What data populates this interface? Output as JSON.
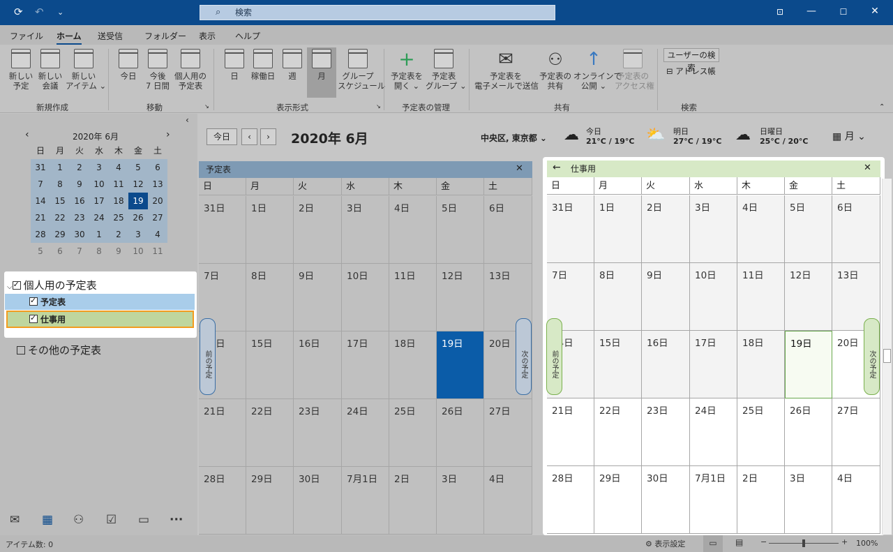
{
  "titlebar": {
    "search_placeholder": "検索",
    "undo": "↶",
    "redo": "↷",
    "more": "⌄"
  },
  "menu": [
    "ファイル",
    "ホーム",
    "送受信",
    "フォルダー",
    "表示",
    "ヘルプ"
  ],
  "ribbon": {
    "groups": [
      "新規作成",
      "移動",
      "表示形式",
      "予定表の管理",
      "共有",
      "検索"
    ],
    "new_appt": "新しい\n予定",
    "new_meeting": "新しい\n会議",
    "new_item": "新しい\nアイテム ⌄",
    "today": "今日",
    "next7": "今後\n7 日間",
    "personal": "個人用の\n予定表",
    "day": "日",
    "workweek": "稼働日",
    "week": "週",
    "month": "月",
    "schedule": "グループ\nスケジュール",
    "open_cal": "予定表を\n開く ⌄",
    "cal_groups": "予定表\nグループ ⌄",
    "email_cal": "予定表を\n電子メールで送信",
    "share_cal": "予定表の\n共有",
    "publish": "オンラインで\n公開 ⌄",
    "perm": "予定表の\nアクセス権",
    "search_people": "ユーザーの検索",
    "address_book": "アドレス帳"
  },
  "minical": {
    "title": "2020年 6月",
    "days": [
      "日",
      "月",
      "火",
      "水",
      "木",
      "金",
      "土"
    ],
    "weeks": [
      [
        "31",
        "1",
        "2",
        "3",
        "4",
        "5",
        "6"
      ],
      [
        "7",
        "8",
        "9",
        "10",
        "11",
        "12",
        "13"
      ],
      [
        "14",
        "15",
        "16",
        "17",
        "18",
        "19",
        "20"
      ],
      [
        "21",
        "22",
        "23",
        "24",
        "25",
        "26",
        "27"
      ],
      [
        "28",
        "29",
        "30",
        "1",
        "2",
        "3",
        "4"
      ],
      [
        "5",
        "6",
        "7",
        "8",
        "9",
        "10",
        "11"
      ]
    ]
  },
  "calendars": {
    "group": "個人用の予定表",
    "cal1": "予定表",
    "cal2": "仕事用",
    "other": "その他の予定表"
  },
  "header": {
    "today_btn": "今日",
    "title": "2020年 6月",
    "location": "中央区, 東京都 ⌄",
    "weather": [
      {
        "label": "今日",
        "temp": "21°C / 19°C"
      },
      {
        "label": "明日",
        "temp": "27°C / 19°C"
      },
      {
        "label": "日曜日",
        "temp": "25°C / 20°C"
      }
    ],
    "view": "月 ⌄"
  },
  "month": {
    "days": [
      "日",
      "月",
      "火",
      "水",
      "木",
      "金",
      "土"
    ],
    "weeks": [
      [
        "31日",
        "1日",
        "2日",
        "3日",
        "4日",
        "5日",
        "6日"
      ],
      [
        "7日",
        "8日",
        "9日",
        "10日",
        "11日",
        "12日",
        "13日"
      ],
      [
        "14日",
        "15日",
        "16日",
        "17日",
        "18日",
        "19日",
        "20日"
      ],
      [
        "21日",
        "22日",
        "23日",
        "24日",
        "25日",
        "26日",
        "27日"
      ],
      [
        "28日",
        "29日",
        "30日",
        "7月1日",
        "2日",
        "3日",
        "4日"
      ]
    ]
  },
  "cal1_title": "予定表",
  "cal2_title": "仕事用",
  "prev_appt": "前の予定",
  "next_appt": "次の予定",
  "status": {
    "items": "アイテム数: 0",
    "view_settings": "表示設定",
    "zoom": "100%"
  }
}
